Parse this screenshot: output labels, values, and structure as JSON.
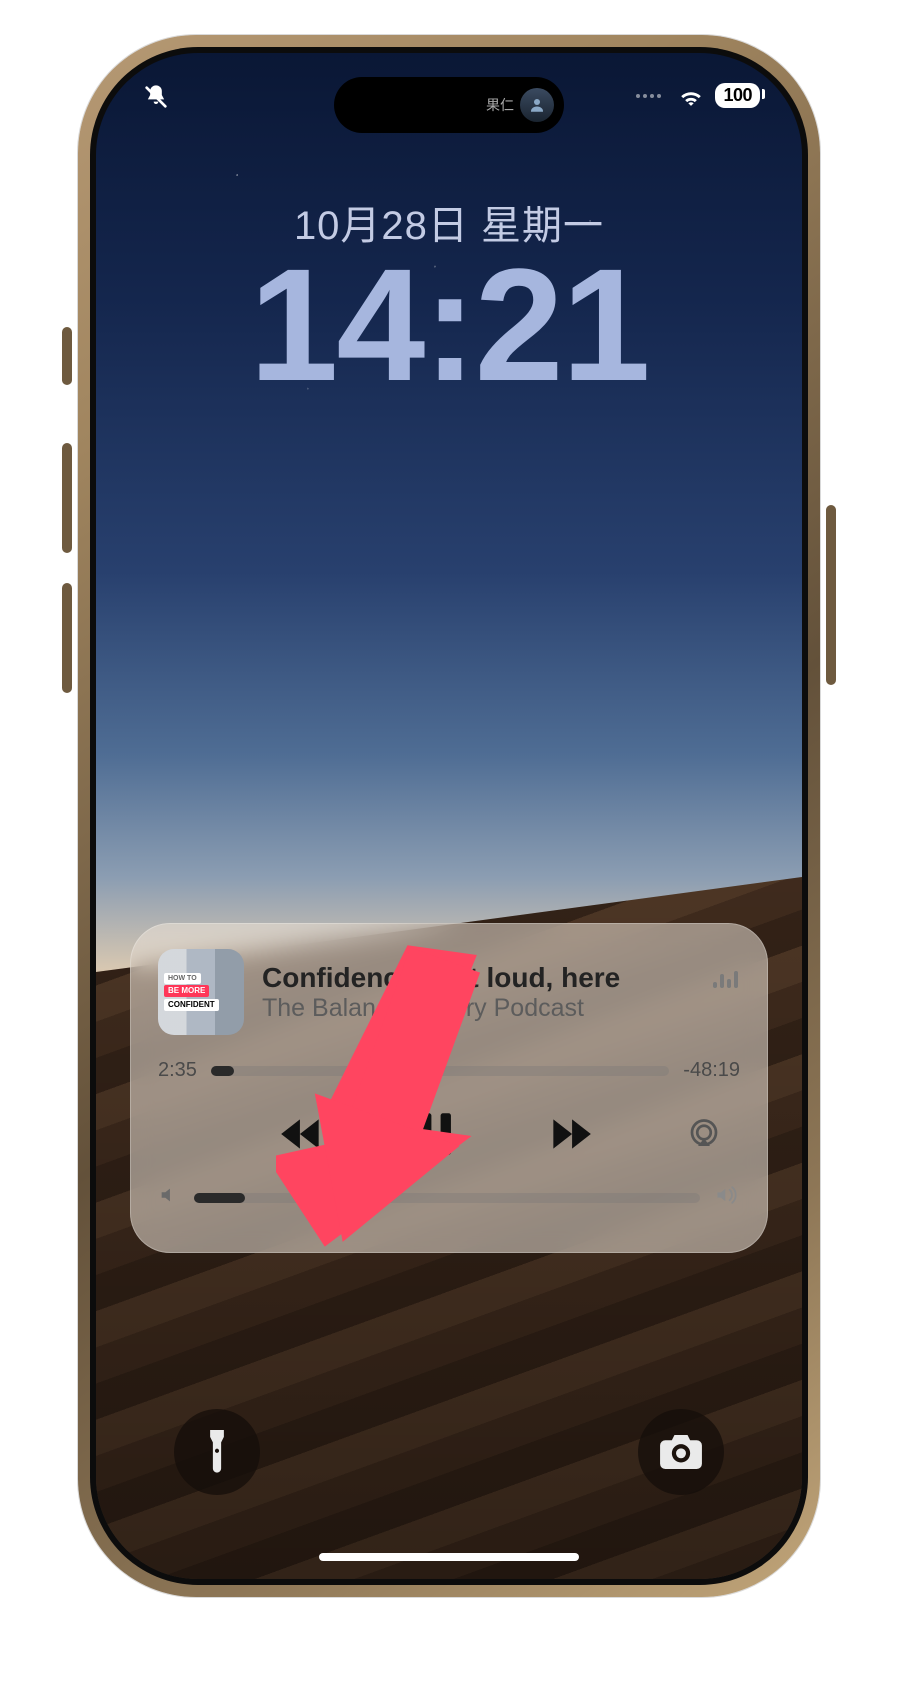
{
  "colors": {
    "accent": "#ff4560"
  },
  "status": {
    "battery": "100",
    "island_name": "果仁"
  },
  "lock": {
    "date": "10月28日 星期一",
    "time": "14:21"
  },
  "player": {
    "artwork_badges": [
      "HOW TO",
      "BE MORE",
      "CONFIDENT"
    ],
    "title": "Confidence isn't loud, here",
    "show": "The Balance Theory Podcast",
    "elapsed": "2:35",
    "remaining": "-48:19",
    "progress_pct": 5,
    "volume_pct": 10
  },
  "icons": {
    "bell_slash": "bell-slash-icon",
    "wifi": "wifi-icon",
    "prev": "skip-back-icon",
    "pause": "pause-icon",
    "next": "skip-forward-icon",
    "airplay": "airplay-icon",
    "vol_low": "volume-low-icon",
    "vol_high": "volume-high-icon",
    "flashlight": "flashlight-icon",
    "camera": "camera-icon"
  },
  "annotation": {
    "type": "arrow",
    "color": "#ff4560",
    "points_to": "skip-back-button"
  }
}
